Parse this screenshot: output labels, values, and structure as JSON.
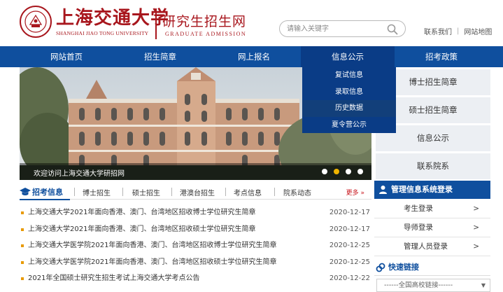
{
  "header": {
    "logo_cn": "上海交通大学",
    "logo_en": "SHANGHAI JIAO TONG UNIVERSITY",
    "site_title_cn": "研究生招生网",
    "site_title_en": "GRADUATE ADMISSION",
    "search_placeholder": "请输入关键字",
    "links": [
      "联系我们",
      "网站地图"
    ],
    "brand_color": "#a8161d"
  },
  "nav": {
    "items": [
      "网站首页",
      "招生简章",
      "网上报名",
      "信息公示",
      "招考政策"
    ],
    "active": "信息公示",
    "color": "#0f4f9e"
  },
  "dropdown": {
    "items": [
      "复试信息",
      "录取信息",
      "历史数据",
      "夏令营公示"
    ],
    "highlighted": "历史数据"
  },
  "banner": {
    "caption": "欢迎访问上海交通大学研招网",
    "slide_count": 4,
    "active_slide": 2
  },
  "sidebar": {
    "items": [
      "博士招生简章",
      "硕士招生简章",
      "信息公示",
      "联系院系"
    ]
  },
  "management": {
    "title": "管理信息系统登录",
    "items": [
      "考生登录",
      "导师登录",
      "管理人员登录"
    ],
    "arrow": ">"
  },
  "quick_links": {
    "title": "快速链接",
    "select_value": "------全国高校链接------"
  },
  "tabs": {
    "main": "招考信息",
    "items": [
      "博士招生",
      "硕士招生",
      "港澳台招生",
      "考点信息",
      "院系动态"
    ],
    "more": "更多 »"
  },
  "news": [
    {
      "title": "上海交通大学2021年面向香港、澳门、台湾地区招收博士学位研究生简章",
      "date": "2020-12-17"
    },
    {
      "title": "上海交通大学2021年面向香港、澳门、台湾地区招收硕士学位研究生简章",
      "date": "2020-12-17"
    },
    {
      "title": "上海交通大学医学院2021年面向香港、澳门、台湾地区招收博士学位研究生简章",
      "date": "2020-12-25"
    },
    {
      "title": "上海交通大学医学院2021年面向香港、澳门、台湾地区招收硕士学位研究生简章",
      "date": "2020-12-25"
    },
    {
      "title": "2021年全国硕士研究生招生考试上海交通大学考点公告",
      "date": "2020-12-22"
    }
  ]
}
